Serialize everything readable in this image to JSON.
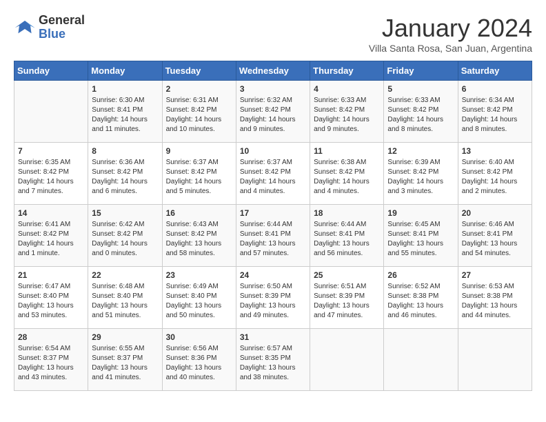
{
  "header": {
    "logo_line1": "General",
    "logo_line2": "Blue",
    "month_title": "January 2024",
    "subtitle": "Villa Santa Rosa, San Juan, Argentina"
  },
  "days_of_week": [
    "Sunday",
    "Monday",
    "Tuesday",
    "Wednesday",
    "Thursday",
    "Friday",
    "Saturday"
  ],
  "weeks": [
    [
      {
        "day": "",
        "info": ""
      },
      {
        "day": "1",
        "info": "Sunrise: 6:30 AM\nSunset: 8:41 PM\nDaylight: 14 hours\nand 11 minutes."
      },
      {
        "day": "2",
        "info": "Sunrise: 6:31 AM\nSunset: 8:42 PM\nDaylight: 14 hours\nand 10 minutes."
      },
      {
        "day": "3",
        "info": "Sunrise: 6:32 AM\nSunset: 8:42 PM\nDaylight: 14 hours\nand 9 minutes."
      },
      {
        "day": "4",
        "info": "Sunrise: 6:33 AM\nSunset: 8:42 PM\nDaylight: 14 hours\nand 9 minutes."
      },
      {
        "day": "5",
        "info": "Sunrise: 6:33 AM\nSunset: 8:42 PM\nDaylight: 14 hours\nand 8 minutes."
      },
      {
        "day": "6",
        "info": "Sunrise: 6:34 AM\nSunset: 8:42 PM\nDaylight: 14 hours\nand 8 minutes."
      }
    ],
    [
      {
        "day": "7",
        "info": "Sunrise: 6:35 AM\nSunset: 8:42 PM\nDaylight: 14 hours\nand 7 minutes."
      },
      {
        "day": "8",
        "info": "Sunrise: 6:36 AM\nSunset: 8:42 PM\nDaylight: 14 hours\nand 6 minutes."
      },
      {
        "day": "9",
        "info": "Sunrise: 6:37 AM\nSunset: 8:42 PM\nDaylight: 14 hours\nand 5 minutes."
      },
      {
        "day": "10",
        "info": "Sunrise: 6:37 AM\nSunset: 8:42 PM\nDaylight: 14 hours\nand 4 minutes."
      },
      {
        "day": "11",
        "info": "Sunrise: 6:38 AM\nSunset: 8:42 PM\nDaylight: 14 hours\nand 4 minutes."
      },
      {
        "day": "12",
        "info": "Sunrise: 6:39 AM\nSunset: 8:42 PM\nDaylight: 14 hours\nand 3 minutes."
      },
      {
        "day": "13",
        "info": "Sunrise: 6:40 AM\nSunset: 8:42 PM\nDaylight: 14 hours\nand 2 minutes."
      }
    ],
    [
      {
        "day": "14",
        "info": "Sunrise: 6:41 AM\nSunset: 8:42 PM\nDaylight: 14 hours\nand 1 minute."
      },
      {
        "day": "15",
        "info": "Sunrise: 6:42 AM\nSunset: 8:42 PM\nDaylight: 14 hours\nand 0 minutes."
      },
      {
        "day": "16",
        "info": "Sunrise: 6:43 AM\nSunset: 8:42 PM\nDaylight: 13 hours\nand 58 minutes."
      },
      {
        "day": "17",
        "info": "Sunrise: 6:44 AM\nSunset: 8:41 PM\nDaylight: 13 hours\nand 57 minutes."
      },
      {
        "day": "18",
        "info": "Sunrise: 6:44 AM\nSunset: 8:41 PM\nDaylight: 13 hours\nand 56 minutes."
      },
      {
        "day": "19",
        "info": "Sunrise: 6:45 AM\nSunset: 8:41 PM\nDaylight: 13 hours\nand 55 minutes."
      },
      {
        "day": "20",
        "info": "Sunrise: 6:46 AM\nSunset: 8:41 PM\nDaylight: 13 hours\nand 54 minutes."
      }
    ],
    [
      {
        "day": "21",
        "info": "Sunrise: 6:47 AM\nSunset: 8:40 PM\nDaylight: 13 hours\nand 53 minutes."
      },
      {
        "day": "22",
        "info": "Sunrise: 6:48 AM\nSunset: 8:40 PM\nDaylight: 13 hours\nand 51 minutes."
      },
      {
        "day": "23",
        "info": "Sunrise: 6:49 AM\nSunset: 8:40 PM\nDaylight: 13 hours\nand 50 minutes."
      },
      {
        "day": "24",
        "info": "Sunrise: 6:50 AM\nSunset: 8:39 PM\nDaylight: 13 hours\nand 49 minutes."
      },
      {
        "day": "25",
        "info": "Sunrise: 6:51 AM\nSunset: 8:39 PM\nDaylight: 13 hours\nand 47 minutes."
      },
      {
        "day": "26",
        "info": "Sunrise: 6:52 AM\nSunset: 8:38 PM\nDaylight: 13 hours\nand 46 minutes."
      },
      {
        "day": "27",
        "info": "Sunrise: 6:53 AM\nSunset: 8:38 PM\nDaylight: 13 hours\nand 44 minutes."
      }
    ],
    [
      {
        "day": "28",
        "info": "Sunrise: 6:54 AM\nSunset: 8:37 PM\nDaylight: 13 hours\nand 43 minutes."
      },
      {
        "day": "29",
        "info": "Sunrise: 6:55 AM\nSunset: 8:37 PM\nDaylight: 13 hours\nand 41 minutes."
      },
      {
        "day": "30",
        "info": "Sunrise: 6:56 AM\nSunset: 8:36 PM\nDaylight: 13 hours\nand 40 minutes."
      },
      {
        "day": "31",
        "info": "Sunrise: 6:57 AM\nSunset: 8:35 PM\nDaylight: 13 hours\nand 38 minutes."
      },
      {
        "day": "",
        "info": ""
      },
      {
        "day": "",
        "info": ""
      },
      {
        "day": "",
        "info": ""
      }
    ]
  ]
}
